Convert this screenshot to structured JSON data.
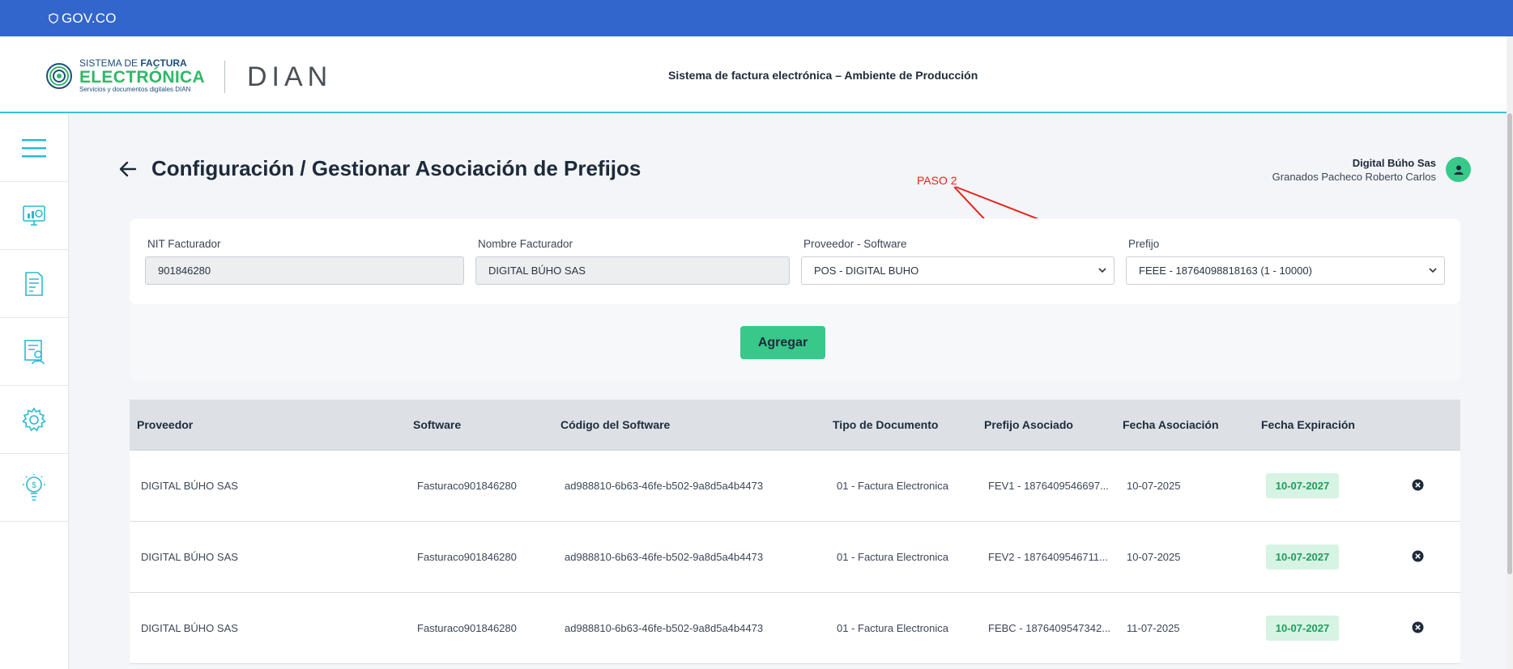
{
  "gov_bar": {
    "text": "GOV.CO"
  },
  "header": {
    "logo_line1_a": "SISTEMA DE ",
    "logo_line1_b": "FACTURA",
    "logo_line2": "ELECTRÓNICA",
    "logo_line3": "Servicios y documentos digitales DIAN",
    "dian": "DIAN",
    "title": "Sistema de factura electrónica – Ambiente de Producción"
  },
  "sidebar": {
    "items": [
      {
        "icon": "menu-icon"
      },
      {
        "icon": "dashboard-monitor-icon"
      },
      {
        "icon": "document-icon"
      },
      {
        "icon": "report-person-icon"
      },
      {
        "icon": "settings-gear-icon"
      },
      {
        "icon": "idea-bulb-icon"
      }
    ]
  },
  "page": {
    "title": "Configuración / Gestionar Asociación de Prefijos",
    "annotation": "PASO 2"
  },
  "user": {
    "company": "Digital Búho Sas",
    "name": "Granados Pacheco Roberto Carlos"
  },
  "form": {
    "nit_label": "NIT Facturador",
    "nit_value": "901846280",
    "nombre_label": "Nombre Facturador",
    "nombre_value": "DIGITAL BÚHO SAS",
    "proveedor_label": "Proveedor - Software",
    "proveedor_value": "POS - DIGITAL BUHO",
    "prefijo_label": "Prefijo",
    "prefijo_value": "FEEE - 18764098818163 (1 - 10000)",
    "add_button": "Agregar"
  },
  "table": {
    "headers": {
      "proveedor": "Proveedor",
      "software": "Software",
      "codigo": "Código del Software",
      "tipo": "Tipo de Documento",
      "prefijo": "Prefijo Asociado",
      "fecha_asoc": "Fecha Asociación",
      "fecha_exp": "Fecha Expiración"
    },
    "rows": [
      {
        "proveedor": "DIGITAL BÚHO SAS",
        "software": "Fasturaco901846280",
        "codigo": "ad988810-6b63-46fe-b502-9a8d5a4b4473",
        "tipo": "01 - Factura Electronica",
        "prefijo": "FEV1 - 1876409546697...",
        "fecha_asoc": "10-07-2025",
        "fecha_exp": "10-07-2027"
      },
      {
        "proveedor": "DIGITAL BÚHO SAS",
        "software": "Fasturaco901846280",
        "codigo": "ad988810-6b63-46fe-b502-9a8d5a4b4473",
        "tipo": "01 - Factura Electronica",
        "prefijo": "FEV2 - 1876409546711...",
        "fecha_asoc": "10-07-2025",
        "fecha_exp": "10-07-2027"
      },
      {
        "proveedor": "DIGITAL BÚHO SAS",
        "software": "Fasturaco901846280",
        "codigo": "ad988810-6b63-46fe-b502-9a8d5a4b4473",
        "tipo": "01 - Factura Electronica",
        "prefijo": "FEBC - 1876409547342...",
        "fecha_asoc": "11-07-2025",
        "fecha_exp": "10-07-2027"
      }
    ]
  },
  "colors": {
    "gov_blue": "#3366cc",
    "accent_green": "#38c98a",
    "annotation_red": "#e8221b"
  }
}
